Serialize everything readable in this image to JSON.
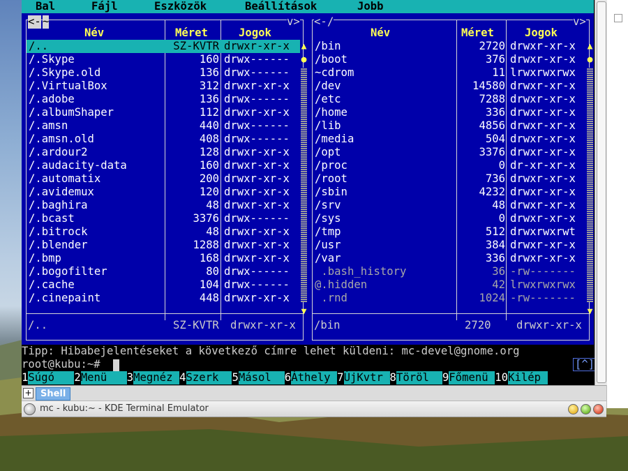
{
  "window": {
    "title": "mc - kubu:~ - KDE Terminal Emulator",
    "tab_label": "Shell",
    "new_tab_symbol": "+"
  },
  "menu": {
    "items": [
      "Bal",
      "Fájl",
      "Eszközök",
      "Beállítások",
      "Jobb"
    ]
  },
  "left_panel": {
    "corner_left": "<-",
    "corner_small": "~",
    "corner_right": "v>",
    "headers": {
      "name": "Név",
      "size": "Méret",
      "perm": "Jogok"
    },
    "rows": [
      {
        "name": "/..",
        "size": "SZ-KVTR",
        "perm": "drwxr-xr-x"
      },
      {
        "name": "/.Skype",
        "size": "160",
        "perm": "drwx------"
      },
      {
        "name": "/.Skype.old",
        "size": "136",
        "perm": "drwx------"
      },
      {
        "name": "/.VirtualBox",
        "size": "312",
        "perm": "drwxr-xr-x"
      },
      {
        "name": "/.adobe",
        "size": "136",
        "perm": "drwx------"
      },
      {
        "name": "/.albumShaper",
        "size": "112",
        "perm": "drwxr-xr-x"
      },
      {
        "name": "/.amsn",
        "size": "440",
        "perm": "drwx------"
      },
      {
        "name": "/.amsn.old",
        "size": "408",
        "perm": "drwx------"
      },
      {
        "name": "/.ardour2",
        "size": "128",
        "perm": "drwxr-xr-x"
      },
      {
        "name": "/.audacity-data",
        "size": "160",
        "perm": "drwxr-xr-x"
      },
      {
        "name": "/.automatix",
        "size": "200",
        "perm": "drwxr-xr-x"
      },
      {
        "name": "/.avidemux",
        "size": "120",
        "perm": "drwxr-xr-x"
      },
      {
        "name": "/.baghira",
        "size": "48",
        "perm": "drwxr-xr-x"
      },
      {
        "name": "/.bcast",
        "size": "3376",
        "perm": "drwx------"
      },
      {
        "name": "/.bitrock",
        "size": "48",
        "perm": "drwxr-xr-x"
      },
      {
        "name": "/.blender",
        "size": "1288",
        "perm": "drwxr-xr-x"
      },
      {
        "name": "/.bmp",
        "size": "168",
        "perm": "drwxr-xr-x"
      },
      {
        "name": "/.bogofilter",
        "size": "80",
        "perm": "drwx------"
      },
      {
        "name": "/.cache",
        "size": "104",
        "perm": "drwx------"
      },
      {
        "name": "/.cinepaint",
        "size": "448",
        "perm": "drwxr-xr-x"
      }
    ],
    "status": {
      "name": "/..",
      "size": "SZ-KVTR",
      "perm": "drwxr-xr-x"
    }
  },
  "right_panel": {
    "corner_left": "<-",
    "corner_small": "/",
    "corner_right": "v>",
    "headers": {
      "name": "Név",
      "size": "Méret",
      "perm": "Jogok"
    },
    "rows": [
      {
        "name": "/bin",
        "size": "2720",
        "perm": "drwxr-xr-x"
      },
      {
        "name": "/boot",
        "size": "376",
        "perm": "drwxr-xr-x"
      },
      {
        "name": "~cdrom",
        "size": "11",
        "perm": "lrwxrwxrwx"
      },
      {
        "name": "/dev",
        "size": "14580",
        "perm": "drwxr-xr-x"
      },
      {
        "name": "/etc",
        "size": "7288",
        "perm": "drwxr-xr-x"
      },
      {
        "name": "/home",
        "size": "336",
        "perm": "drwxr-xr-x"
      },
      {
        "name": "/lib",
        "size": "4856",
        "perm": "drwxr-xr-x"
      },
      {
        "name": "/media",
        "size": "504",
        "perm": "drwxr-xr-x"
      },
      {
        "name": "/opt",
        "size": "3376",
        "perm": "drwxr-xr-x"
      },
      {
        "name": "/proc",
        "size": "0",
        "perm": "dr-xr-xr-x"
      },
      {
        "name": "/root",
        "size": "736",
        "perm": "drwxr-xr-x"
      },
      {
        "name": "/sbin",
        "size": "4232",
        "perm": "drwxr-xr-x"
      },
      {
        "name": "/srv",
        "size": "48",
        "perm": "drwxr-xr-x"
      },
      {
        "name": "/sys",
        "size": "0",
        "perm": "drwxr-xr-x"
      },
      {
        "name": "/tmp",
        "size": "512",
        "perm": "drwxrwxrwt"
      },
      {
        "name": "/usr",
        "size": "384",
        "perm": "drwxr-xr-x"
      },
      {
        "name": "/var",
        "size": "336",
        "perm": "drwxr-xr-x"
      },
      {
        "name": " .bash_history",
        "size": "36",
        "perm": "-rw-------",
        "dim": true
      },
      {
        "name": "@.hidden",
        "size": "42",
        "perm": "lrwxrwxrwx",
        "dim": true
      },
      {
        "name": " .rnd",
        "size": "1024",
        "perm": "-rw-------",
        "dim": true
      }
    ],
    "status": {
      "name": "/bin",
      "size": "2720",
      "perm": "drwxr-xr-x"
    }
  },
  "hint": "Tipp: Hibabejelentéseket a következő címre lehet küldeni: mc-devel@gnome.org",
  "prompt": "root@kubu:~#",
  "indicator": "[^]",
  "fkeys": [
    {
      "num": "1",
      "label": "Súgó"
    },
    {
      "num": "2",
      "label": "Menü"
    },
    {
      "num": "3",
      "label": "Megnéz"
    },
    {
      "num": "4",
      "label": "Szerk"
    },
    {
      "num": "5",
      "label": "Másol"
    },
    {
      "num": "6",
      "label": "Áthely"
    },
    {
      "num": "7",
      "label": "ÚjKvtr"
    },
    {
      "num": "8",
      "label": "Töröl"
    },
    {
      "num": "9",
      "label": "Főmenü"
    },
    {
      "num": "10",
      "label": "Kilép"
    }
  ],
  "colors": {
    "panel_bg": "#0000aa",
    "selection": "#18b2b2",
    "header_yellow": "#ffff54"
  }
}
